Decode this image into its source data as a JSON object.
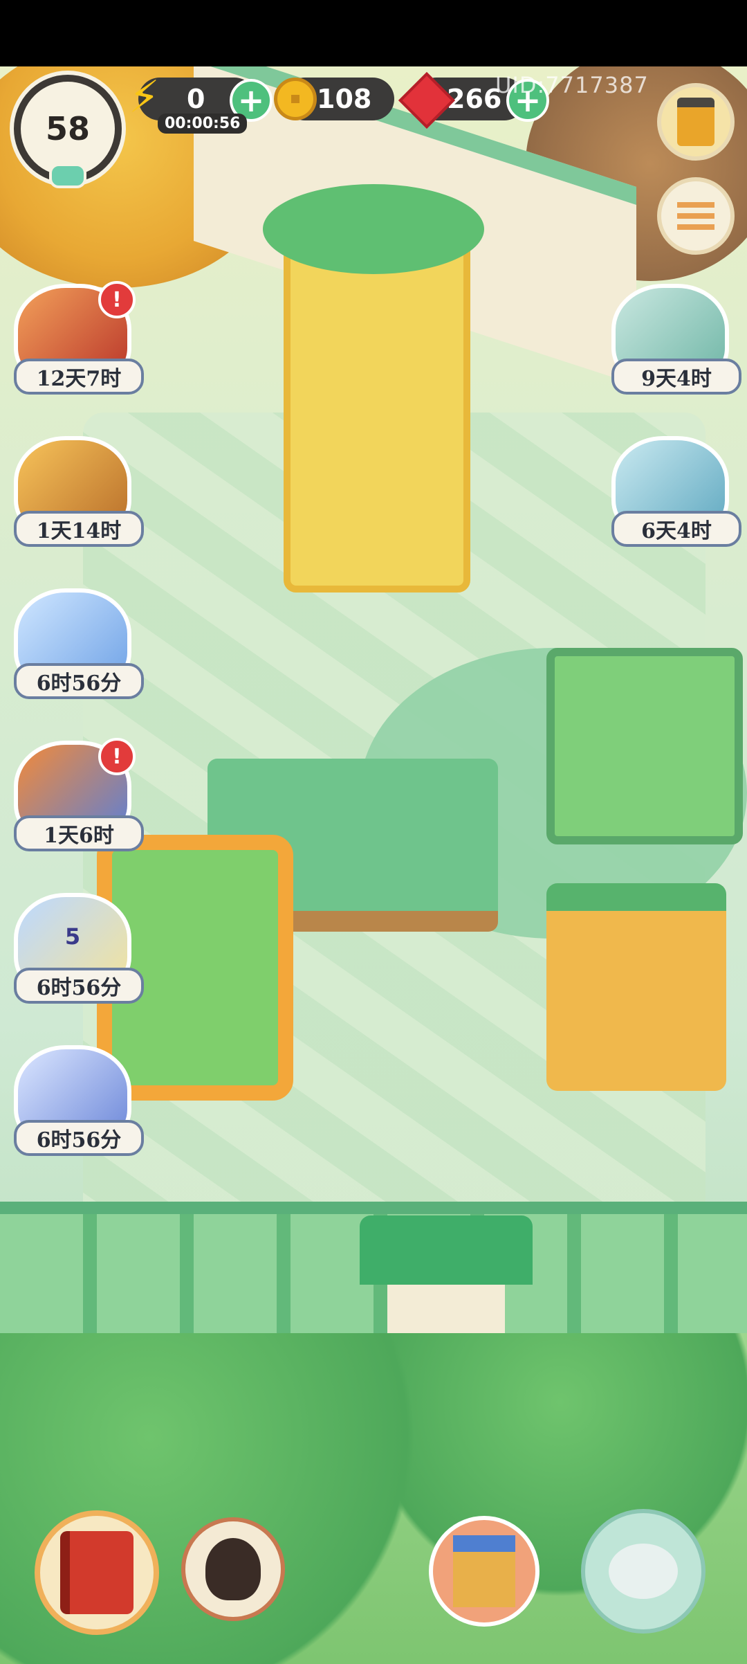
{
  "hud": {
    "level": "58",
    "energy": "0",
    "energy_timer": "00:00:56",
    "coins": "108",
    "gems": "266",
    "uid": "UID:7717387",
    "plus_glyph": "+"
  },
  "events": [
    {
      "name": "event-book",
      "label": "12天7时",
      "alert": "!"
    },
    {
      "name": "event-treasure",
      "label": "1天14时"
    },
    {
      "name": "event-snowman",
      "label": "6时56分"
    },
    {
      "name": "event-warrior",
      "label": "1天6时",
      "alert": "!"
    },
    {
      "name": "event-lotus",
      "label": "6时56分",
      "badge": "5"
    },
    {
      "name": "event-swordsman",
      "label": "6时56分"
    }
  ],
  "right_events": [
    {
      "name": "event-cat-bath",
      "label": "9天4时"
    },
    {
      "name": "event-cat-box",
      "label": "6天4时"
    }
  ],
  "colors": {
    "hud_pill": "#3b3a39",
    "plus": "#4ec07d",
    "alert": "#e23b3b",
    "label_border": "#6a7ea0"
  },
  "icons": [
    "lightning-icon",
    "coin-icon",
    "ruby-icon",
    "lantern-icon",
    "menu-icon",
    "book-icon",
    "character-icon",
    "shop-icon",
    "teapot-icon"
  ]
}
